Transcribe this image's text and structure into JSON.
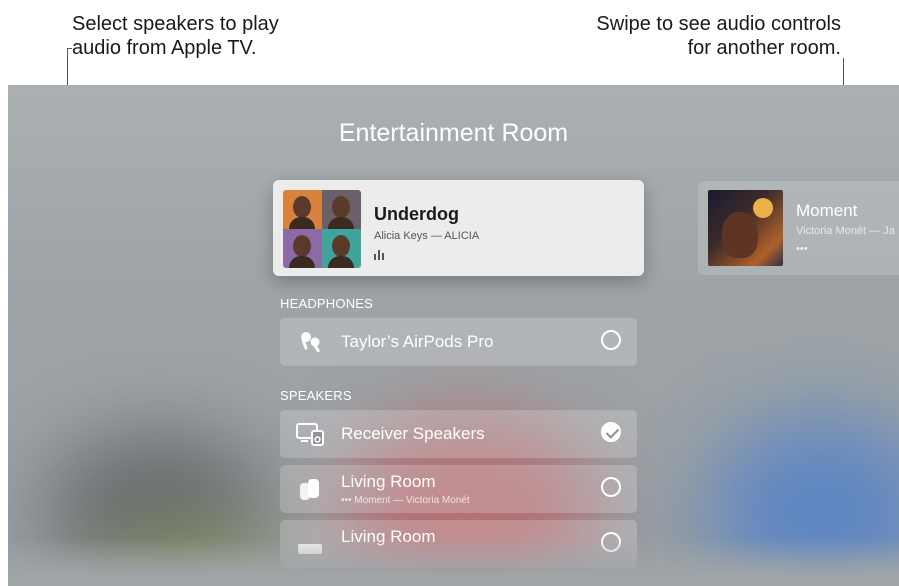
{
  "callouts": {
    "left": [
      "Select speakers to play",
      "audio from Apple TV."
    ],
    "right": [
      "Swipe to see audio controls",
      "for another room."
    ]
  },
  "room": {
    "title": "Entertainment Room"
  },
  "now_playing": {
    "title": "Underdog",
    "subtitle": "Alicia Keys — ALICIA"
  },
  "other_room": {
    "title": "Moment",
    "subtitle": "Victoria Monét — Ja",
    "dots": "•••"
  },
  "headphones": {
    "header": "HEADPHONES",
    "items": [
      {
        "label": "Taylor’s AirPods Pro",
        "selected": false,
        "icon": "airpods-icon"
      }
    ]
  },
  "speakers": {
    "header": "SPEAKERS",
    "items": [
      {
        "label": "Receiver Speakers",
        "selected": true,
        "icon": "receiver-speakers-icon"
      },
      {
        "label": "Living Room",
        "sub": "••• Moment — Victoria Monét",
        "selected": false,
        "icon": "homepod-icon"
      },
      {
        "label": "Living Room",
        "selected": false,
        "icon": "apple-tv-icon"
      }
    ]
  },
  "colors": {
    "row_bg": "rgba(255,255,255,0.2)",
    "screen_bg": "#a2a8ab"
  }
}
